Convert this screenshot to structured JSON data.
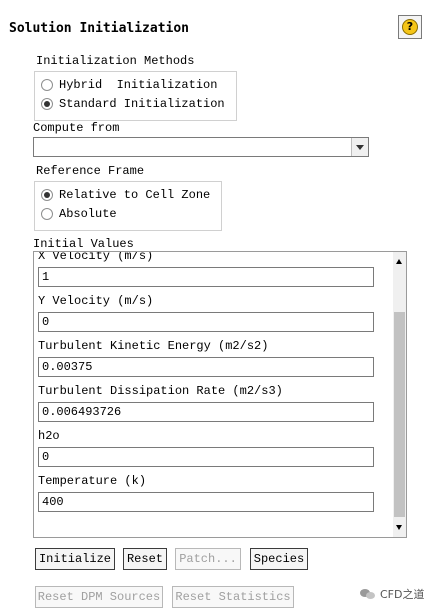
{
  "title": "Solution Initialization",
  "help_icon_text": "?",
  "initialization_methods": {
    "label": "Initialization Methods",
    "options": [
      {
        "label": "Hybrid  Initialization",
        "selected": false
      },
      {
        "label": "Standard Initialization",
        "selected": true
      }
    ]
  },
  "compute_from": {
    "label": "Compute from",
    "value": ""
  },
  "reference_frame": {
    "label": "Reference Frame",
    "options": [
      {
        "label": "Relative to Cell Zone",
        "selected": true
      },
      {
        "label": "Absolute",
        "selected": false
      }
    ]
  },
  "initial_values": {
    "label": "Initial Values",
    "fields": [
      {
        "label": "X Velocity (m/s)",
        "value": "1"
      },
      {
        "label": "Y Velocity (m/s)",
        "value": "0"
      },
      {
        "label": "Turbulent Kinetic Energy (m2/s2)",
        "value": "0.00375"
      },
      {
        "label": "Turbulent Dissipation Rate (m2/s3)",
        "value": "0.006493726"
      },
      {
        "label": "h2o",
        "value": "0"
      },
      {
        "label": "Temperature (k)",
        "value": "400"
      }
    ]
  },
  "buttons": {
    "initialize": "Initialize",
    "reset": "Reset",
    "patch": "Patch...",
    "species": "Species",
    "reset_dpm_sources": "Reset DPM Sources",
    "reset_statistics": "Reset Statistics"
  },
  "watermark": "CFD之道"
}
